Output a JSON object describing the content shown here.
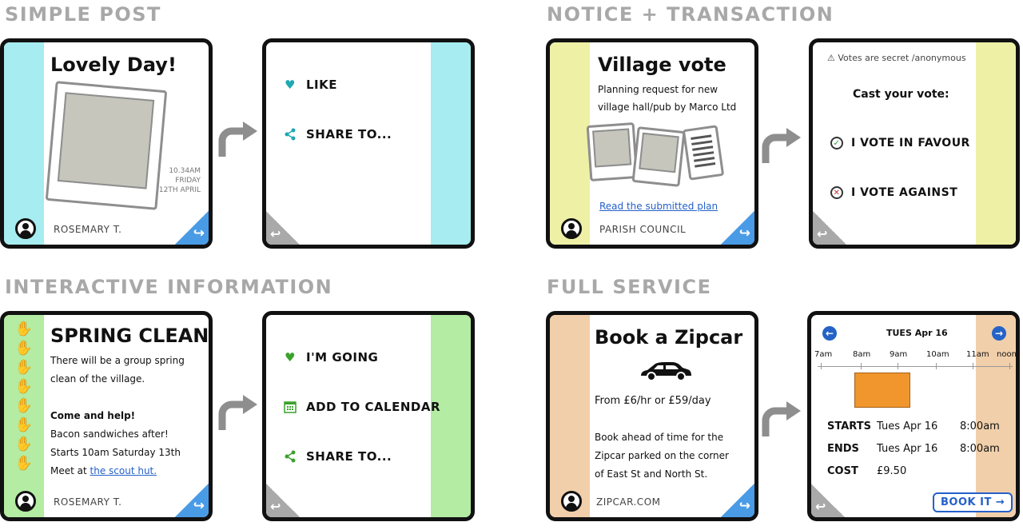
{
  "sections": {
    "simple_post": "SIMPLE POST",
    "notice_transaction": "NOTICE + TRANSACTION",
    "interactive_information": "INTERACTIVE INFORMATION",
    "full_service": "FULL SERVICE"
  },
  "colors": {
    "cyan": "#a6ecf0",
    "yellow": "#eef0a6",
    "green": "#b3eca2",
    "peach": "#f1cfaa",
    "fold_blue": "#4a9be6",
    "fold_grey": "#a9a9a9",
    "link_blue": "#2461c9",
    "orange_block": "#f0962c"
  },
  "simple_post": {
    "front": {
      "title": "Lovely Day!",
      "time": "10.34AM",
      "day": "FRIDAY",
      "date": "12TH APRIL",
      "author": "ROSEMARY T."
    },
    "back": {
      "like": "LIKE",
      "share": "SHARE TO..."
    }
  },
  "notice": {
    "front": {
      "title": "Village vote",
      "line1": "Planning request for new",
      "line2": "village hall/pub by Marco Ltd",
      "link": "Read the submitted plan",
      "author": "PARISH COUNCIL"
    },
    "back": {
      "secret": "Votes are secret /anonymous",
      "cast": "Cast your vote:",
      "favour": "I VOTE IN FAVOUR",
      "against": "I VOTE AGAINST"
    }
  },
  "interactive": {
    "front": {
      "title": "SPRING CLEAN",
      "line1": "There will be a group spring",
      "line2": "clean of the village.",
      "line3": "Come and help!",
      "line4": "Bacon sandwiches after!",
      "line5": "Starts 10am Saturday 13th",
      "line6_prefix": "Meet at ",
      "line6_link": "the scout hut.",
      "author": "ROSEMARY T."
    },
    "back": {
      "going": "I'M GOING",
      "calendar": "ADD TO CALENDAR",
      "share": "SHARE TO..."
    }
  },
  "full_service": {
    "front": {
      "title": "Book a Zipcar",
      "price": "From £6/hr or £59/day",
      "line1": "Book ahead of time for the",
      "line2": "Zipcar parked on the corner",
      "line3": "of East St and North St.",
      "author": "ZIPCAR.COM"
    },
    "back": {
      "date": "TUES Apr 16",
      "times": [
        "7am",
        "8am",
        "9am",
        "10am",
        "11am",
        "noon"
      ],
      "starts_label": "STARTS",
      "starts_day": "Tues Apr 16",
      "starts_time": "8:00am",
      "ends_label": "ENDS",
      "ends_day": "Tues Apr 16",
      "ends_time": "8:00am",
      "cost_label": "COST",
      "cost_value": "£9.50",
      "book": "BOOK IT"
    }
  }
}
